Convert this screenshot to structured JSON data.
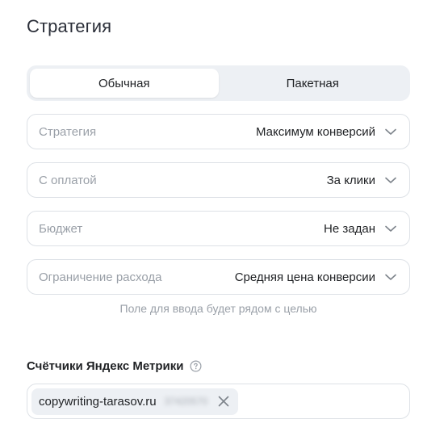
{
  "page": {
    "title": "Стратегия"
  },
  "mode_switch": {
    "options": [
      {
        "label": "Обычная",
        "selected": true
      },
      {
        "label": "Пакетная",
        "selected": false
      }
    ]
  },
  "fields": [
    {
      "label": "Стратегия",
      "value": "Максимум конверсий",
      "icon": "chevron-down-icon"
    },
    {
      "label": "С оплатой",
      "value": "За клики",
      "icon": "chevron-down-icon"
    },
    {
      "label": "Бюджет",
      "value": "Не задан",
      "icon": "chevron-down-icon"
    },
    {
      "label": "Ограничение расхода",
      "value": "Средняя цена конверсии",
      "icon": "chevron-down-icon"
    }
  ],
  "hint": "Поле для ввода будет рядом с целью",
  "metrika": {
    "label": "Счётчики Яндекс Метрики",
    "help_icon": "question-circle-icon",
    "tags": [
      {
        "text": "copywriting-tarasov.ru",
        "id": "37420570",
        "remove_icon": "close-icon"
      }
    ]
  },
  "colors": {
    "text": "#1f2124",
    "muted": "#9aa0a8",
    "border": "#dde1e6",
    "segment_bg": "#edf0f4",
    "chip_bg": "#edf0f4"
  }
}
